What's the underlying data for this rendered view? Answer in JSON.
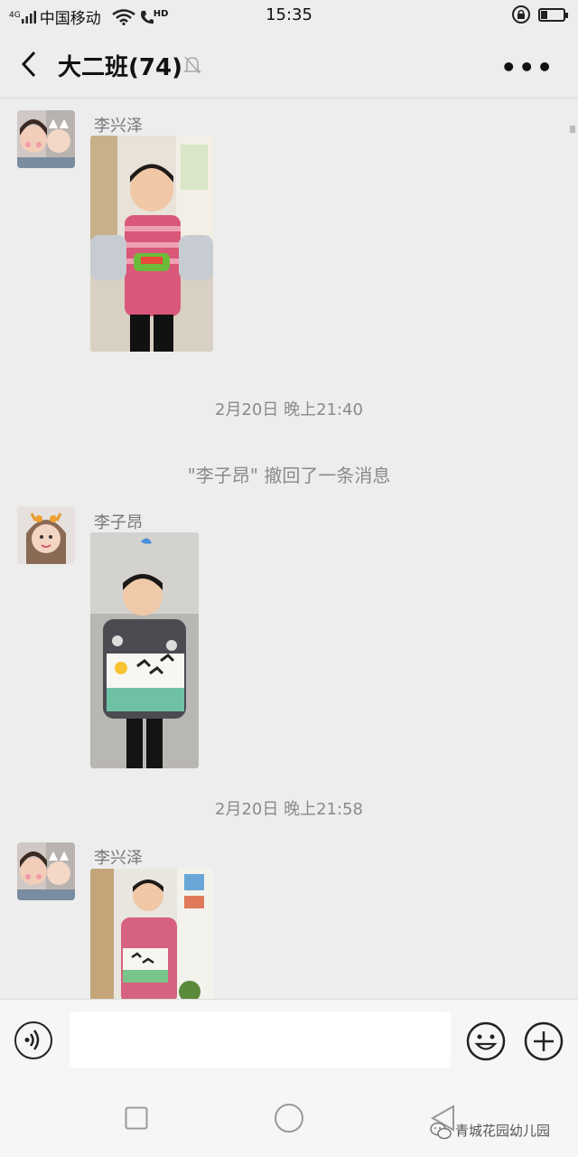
{
  "status_bar": {
    "network": "4G",
    "carrier": "中国移动",
    "hd": "HD",
    "time": "15:35"
  },
  "nav": {
    "title": "大二班(74)"
  },
  "messages": [
    {
      "sender": "李兴泽",
      "avatar": "girl-with-child-avatar"
    },
    {
      "timestamp": "2月20日 晚上21:40"
    },
    {
      "system_text": "\"李子昂\" 撤回了一条消息"
    },
    {
      "sender": "李子昂",
      "avatar": "woman-with-antlers-avatar"
    },
    {
      "timestamp": "2月20日 晚上21:58"
    },
    {
      "sender": "李兴泽",
      "avatar": "girl-with-child-avatar"
    }
  ],
  "input": {
    "placeholder": ""
  },
  "watermark": "青城花园幼儿园",
  "colors": {
    "background": "#ededed",
    "input_bar": "#f6f6f6"
  }
}
